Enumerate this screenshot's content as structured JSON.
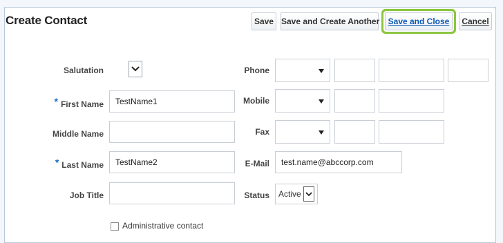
{
  "header": {
    "title": "Create Contact",
    "buttons": {
      "save": "Save",
      "save_and_create_another": "Save and Create Another",
      "save_and_close": "Save and Close",
      "cancel": "Cancel"
    }
  },
  "colors": {
    "accent": "#8cc63e",
    "link": "#0a57b5",
    "required": "#1a6fc9"
  },
  "left_form": {
    "salutation": {
      "label": "Salutation",
      "value": ""
    },
    "first_name": {
      "label": "First Name",
      "value": "TestName1",
      "required_mark": "*"
    },
    "middle_name": {
      "label": "Middle Name",
      "value": ""
    },
    "last_name": {
      "label": "Last Name",
      "value": "TestName2",
      "required_mark": "*"
    },
    "job_title": {
      "label": "Job Title",
      "value": ""
    },
    "admin_contact": {
      "label": "Administrative contact",
      "checked": false
    }
  },
  "right_form": {
    "phone": {
      "label": "Phone"
    },
    "mobile": {
      "label": "Mobile"
    },
    "fax": {
      "label": "Fax"
    },
    "email": {
      "label": "E-Mail",
      "value": "test.name@abccorp.com"
    },
    "status": {
      "label": "Status",
      "value": "Active"
    }
  }
}
